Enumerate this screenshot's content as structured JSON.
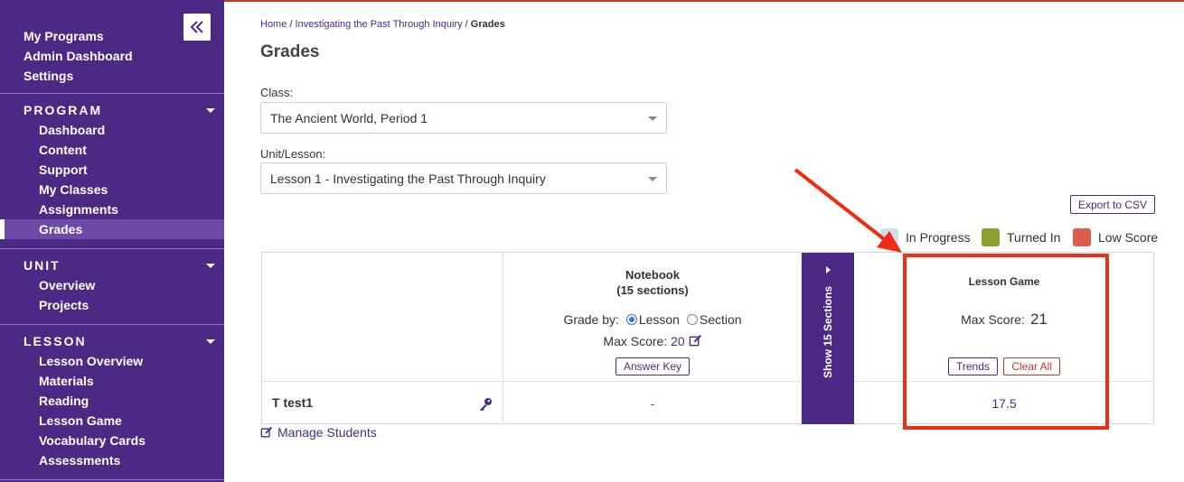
{
  "sidebar": {
    "top_links": [
      "My Programs",
      "Admin Dashboard",
      "Settings"
    ],
    "program": {
      "title": "PROGRAM",
      "items": [
        "Dashboard",
        "Content",
        "Support",
        "My Classes",
        "Assignments",
        "Grades"
      ]
    },
    "unit": {
      "title": "UNIT",
      "items": [
        "Overview",
        "Projects"
      ]
    },
    "lesson": {
      "title": "LESSON",
      "items": [
        "Lesson Overview",
        "Materials",
        "Reading",
        "Lesson Game",
        "Vocabulary Cards",
        "Assessments"
      ]
    }
  },
  "breadcrumb": {
    "home": "Home",
    "separator": "/",
    "program": "Investigating the Past Through Inquiry",
    "current": "Grades"
  },
  "page": {
    "title": "Grades"
  },
  "filters": {
    "class_label": "Class:",
    "class_value": "The Ancient World, Period 1",
    "lesson_label": "Unit/Lesson:",
    "lesson_value": "Lesson 1 - Investigating the Past Through Inquiry"
  },
  "export_label": "Export to CSV",
  "legend": [
    {
      "label": "In Progress",
      "color": "#cfe0ea"
    },
    {
      "label": "Turned In",
      "color": "#8ea12f"
    },
    {
      "label": "Low Score",
      "color": "#dd5c4c"
    }
  ],
  "notebook": {
    "title": "Notebook",
    "subtitle": "(15 sections)",
    "grade_by_label": "Grade by:",
    "option_lesson": "Lesson",
    "option_section": "Section",
    "selected": "Lesson",
    "max_score_label": "Max Score:",
    "max_score": "20",
    "answer_key": "Answer Key"
  },
  "show_sections": "Show 15 Sections",
  "lesson_game": {
    "title": "Lesson Game",
    "max_score_label": "Max Score:",
    "max_score": "21",
    "trends": "Trends",
    "clear_all": "Clear All"
  },
  "students": [
    {
      "name": "T test1",
      "notebook": "-",
      "lesson_game": "17.5"
    }
  ],
  "manage_students": "Manage Students",
  "colors": {
    "sidebar": "#4a2a84",
    "accent": "#4a2a84",
    "highlight": "#f02c15"
  }
}
